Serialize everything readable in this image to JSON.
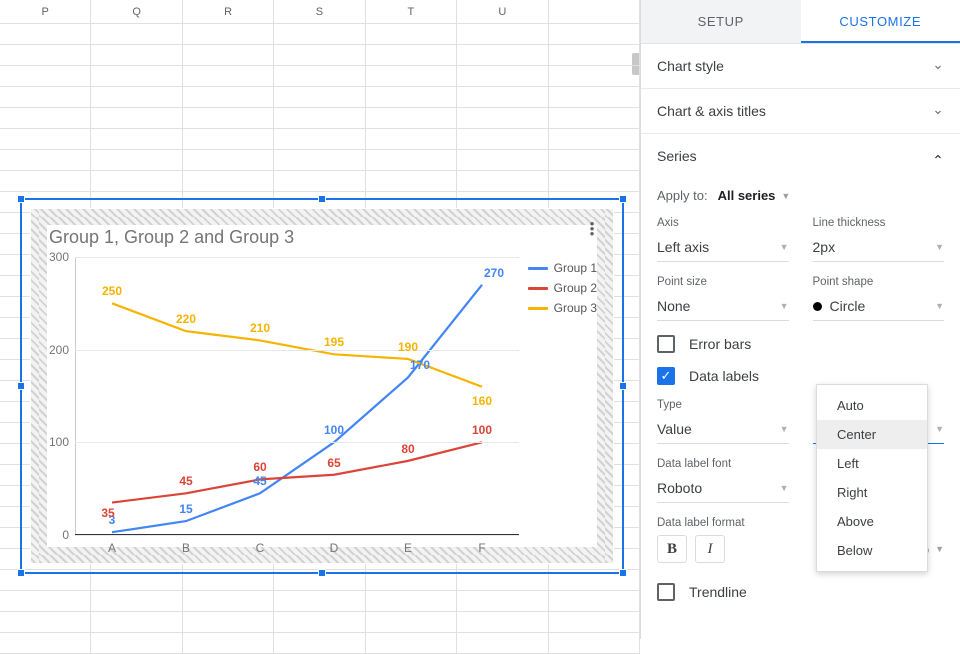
{
  "columns": [
    "P",
    "Q",
    "R",
    "S",
    "T",
    "U",
    ""
  ],
  "chart_data": {
    "type": "line",
    "title": "Group 1, Group 2 and Group 3",
    "categories": [
      "A",
      "B",
      "C",
      "D",
      "E",
      "F"
    ],
    "series": [
      {
        "name": "Group 1",
        "color": "#4285f4",
        "values": [
          3,
          15,
          45,
          100,
          170,
          270
        ]
      },
      {
        "name": "Group 2",
        "color": "#db4437",
        "values": [
          35,
          45,
          60,
          65,
          80,
          100
        ]
      },
      {
        "name": "Group 3",
        "color": "#f4b400",
        "values": [
          250,
          220,
          210,
          195,
          190,
          160
        ]
      }
    ],
    "ylim": [
      0,
      300
    ],
    "yticks": [
      0,
      100,
      200,
      300
    ]
  },
  "panel": {
    "tabs": {
      "setup": "SETUP",
      "customize": "CUSTOMIZE"
    },
    "sections": {
      "chart_style": "Chart style",
      "axis_titles": "Chart & axis titles",
      "series": "Series"
    },
    "apply_to_label": "Apply to:",
    "apply_to_value": "All series",
    "axis": {
      "label": "Axis",
      "value": "Left axis"
    },
    "line_thickness": {
      "label": "Line thickness",
      "value": "2px"
    },
    "point_size": {
      "label": "Point size",
      "value": "None"
    },
    "point_shape": {
      "label": "Point shape",
      "value": "Circle"
    },
    "error_bars": "Error bars",
    "data_labels": "Data labels",
    "type_field": {
      "label": "Type",
      "value": "Value"
    },
    "data_label_font": {
      "label": "Data label font",
      "value": "Roboto"
    },
    "data_label_format": "Data label format",
    "format_auto": "Auto",
    "trendline": "Trendline",
    "dropdown_options": [
      "Auto",
      "Center",
      "Left",
      "Right",
      "Above",
      "Below"
    ],
    "dropdown_hover": "Center"
  }
}
